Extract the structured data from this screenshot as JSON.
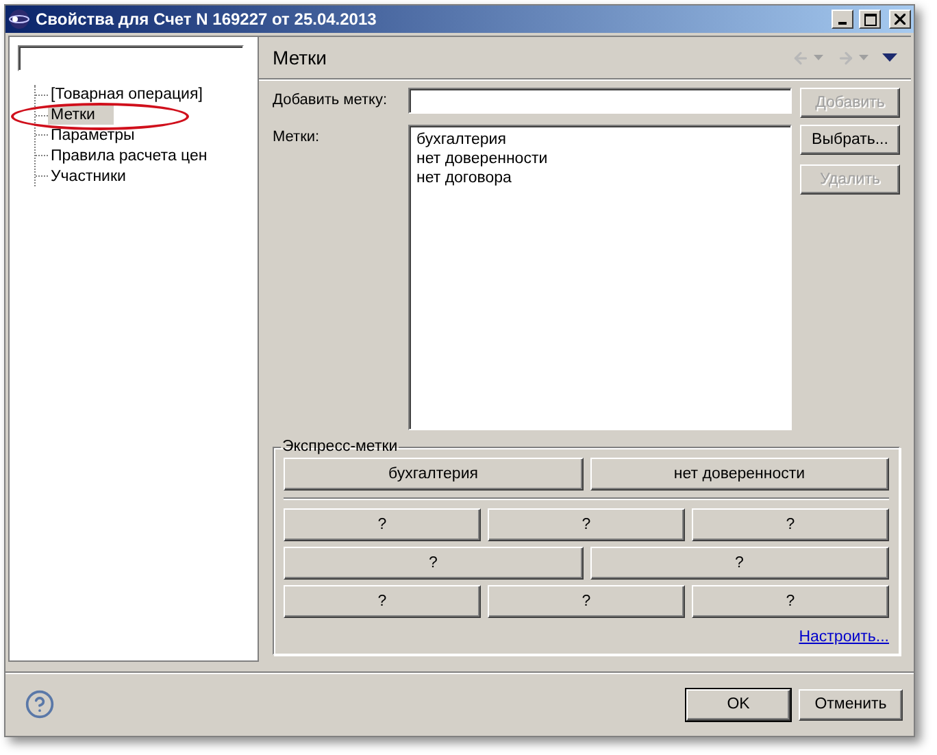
{
  "window": {
    "title": "Свойства для Счет N 169227 от 25.04.2013"
  },
  "tree": [
    {
      "label": "[Товарная операция]",
      "selected": false,
      "circled": false
    },
    {
      "label": "Метки",
      "selected": true,
      "circled": true
    },
    {
      "label": "Параметры",
      "selected": false,
      "circled": false
    },
    {
      "label": "Правила расчета цен",
      "selected": false,
      "circled": false
    },
    {
      "label": "Участники",
      "selected": false,
      "circled": false
    }
  ],
  "page": {
    "title": "Метки",
    "back_enabled": false,
    "forward_enabled": false
  },
  "add_tag": {
    "label": "Добавить метку:",
    "button": {
      "label": "Добавить",
      "disabled": true
    }
  },
  "tags": {
    "label": "Метки:",
    "items": [
      "бухгалтерия",
      "нет доверенности",
      "нет договора"
    ],
    "buttons": [
      {
        "label": "Выбрать...",
        "disabled": false
      },
      {
        "label": "Удалить",
        "disabled": true
      }
    ]
  },
  "express": {
    "title": "Экспресс-метки",
    "tags": [
      "бухгалтерия",
      "нет доверенности"
    ],
    "slot_rows": [
      [
        "?",
        "?",
        "?"
      ],
      [
        "?",
        "?"
      ],
      [
        "?",
        "?",
        "?"
      ]
    ],
    "link": "Настроить..."
  },
  "buttons": [
    {
      "label": "OK",
      "default": true
    },
    {
      "label": "Отменить",
      "default": false
    }
  ]
}
